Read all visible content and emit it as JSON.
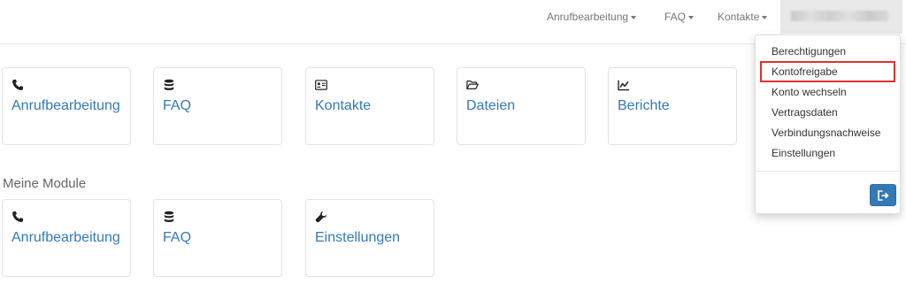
{
  "navbar": {
    "items": [
      {
        "label": "Anrufbearbeitung"
      },
      {
        "label": "FAQ"
      },
      {
        "label": "Kontakte"
      }
    ]
  },
  "tiles": [
    {
      "label": "Anrufbearbeitung",
      "icon": "phone-icon"
    },
    {
      "label": "FAQ",
      "icon": "database-icon"
    },
    {
      "label": "Kontakte",
      "icon": "contact-card-icon"
    },
    {
      "label": "Dateien",
      "icon": "folder-open-icon"
    },
    {
      "label": "Berichte",
      "icon": "chart-line-icon"
    }
  ],
  "modules": {
    "title": "Meine Module",
    "tiles": [
      {
        "label": "Anrufbearbeitung",
        "icon": "phone-icon"
      },
      {
        "label": "FAQ",
        "icon": "database-icon"
      },
      {
        "label": "Einstellungen",
        "icon": "wrench-icon"
      }
    ]
  },
  "dropdown": {
    "items": [
      {
        "label": "Berechtigungen"
      },
      {
        "label": "Kontofreigabe"
      },
      {
        "label": "Konto wechseln"
      },
      {
        "label": "Vertragsdaten"
      },
      {
        "label": "Verbindungsnachweise"
      },
      {
        "label": "Einstellungen"
      }
    ],
    "logout_icon": "logout-icon"
  },
  "colors": {
    "link": "#337ab7",
    "highlight": "#e03030"
  }
}
